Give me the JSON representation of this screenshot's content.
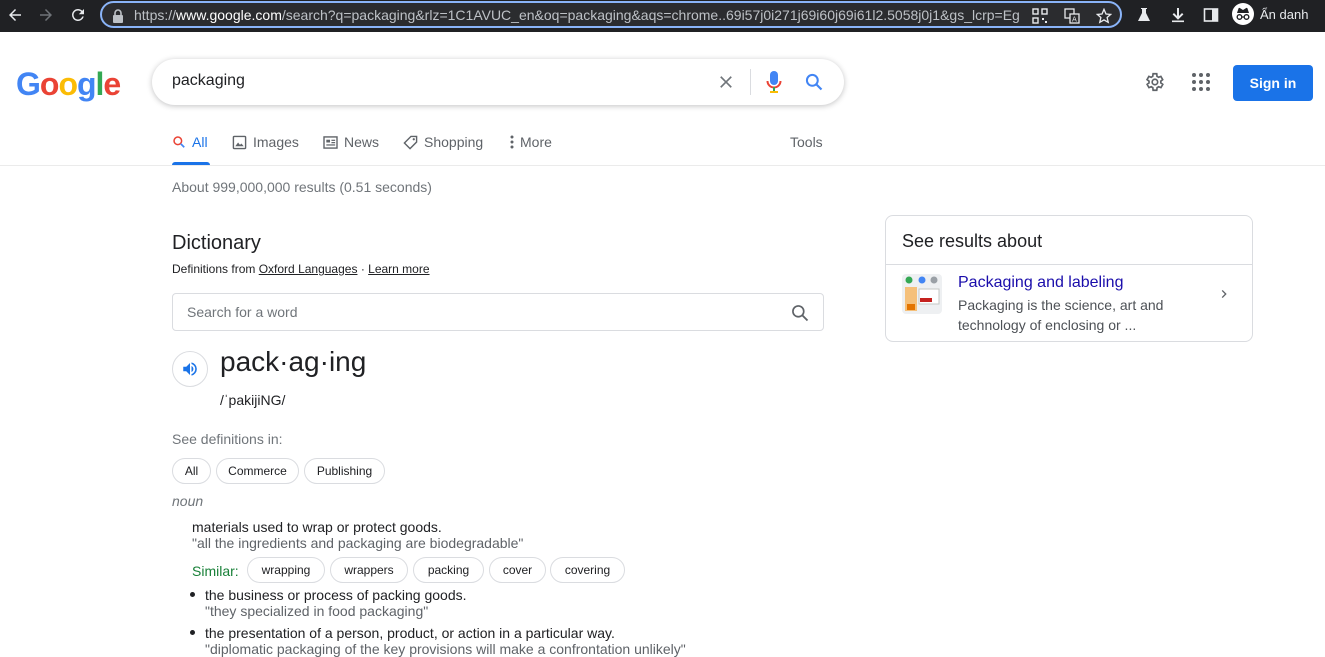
{
  "browser": {
    "url_prefix": "https://",
    "url_host": "www.google.com",
    "url_rest": "/search?q=packaging&rlz=1C1AVUC_en&oq=packaging&aqs=chrome..69i57j0i271j69i60j69i61l2.5058j0j1&gs_lcrp=Eg",
    "profile_label": "Ẩn danh"
  },
  "logo": {
    "l1": "G",
    "l2": "o",
    "l3": "o",
    "l4": "g",
    "l5": "l",
    "l6": "e"
  },
  "search": {
    "query": "packaging"
  },
  "header": {
    "signin_label": "Sign in"
  },
  "tabs": [
    {
      "label": "All"
    },
    {
      "label": "Images"
    },
    {
      "label": "News"
    },
    {
      "label": "Shopping"
    },
    {
      "label": "More"
    }
  ],
  "tools_label": "Tools",
  "result_stats": "About 999,000,000 results (0.51 seconds)",
  "dictionary": {
    "title": "Dictionary",
    "from_prefix": "Definitions from",
    "source_link": "Oxford Languages",
    "separator": "·",
    "learn_more": "Learn more",
    "search_placeholder": "Search for a word",
    "headword": "pack·ag·ing",
    "phonetic": "/ˈpakijiNG/",
    "see_defs_label": "See definitions in:",
    "filters": [
      "All",
      "Commerce",
      "Publishing"
    ],
    "part_of_speech": "noun",
    "definitions": [
      {
        "text": "materials used to wrap or protect goods.",
        "example": "\"all the ingredients and packaging are biodegradable\""
      },
      {
        "text": "the business or process of packing goods.",
        "example": "\"they specialized in food packaging\""
      },
      {
        "text": "the presentation of a person, product, or action in a particular way.",
        "example": "\"diplomatic packaging of the key provisions will make a confrontation unlikely\""
      }
    ],
    "similar_label": "Similar:",
    "similar": [
      "wrapping",
      "wrappers",
      "packing",
      "cover",
      "covering"
    ]
  },
  "knowledge_panel": {
    "title": "See results about",
    "link": "Packaging and labeling",
    "snippet": "Packaging is the science, art and technology of enclosing or ..."
  }
}
